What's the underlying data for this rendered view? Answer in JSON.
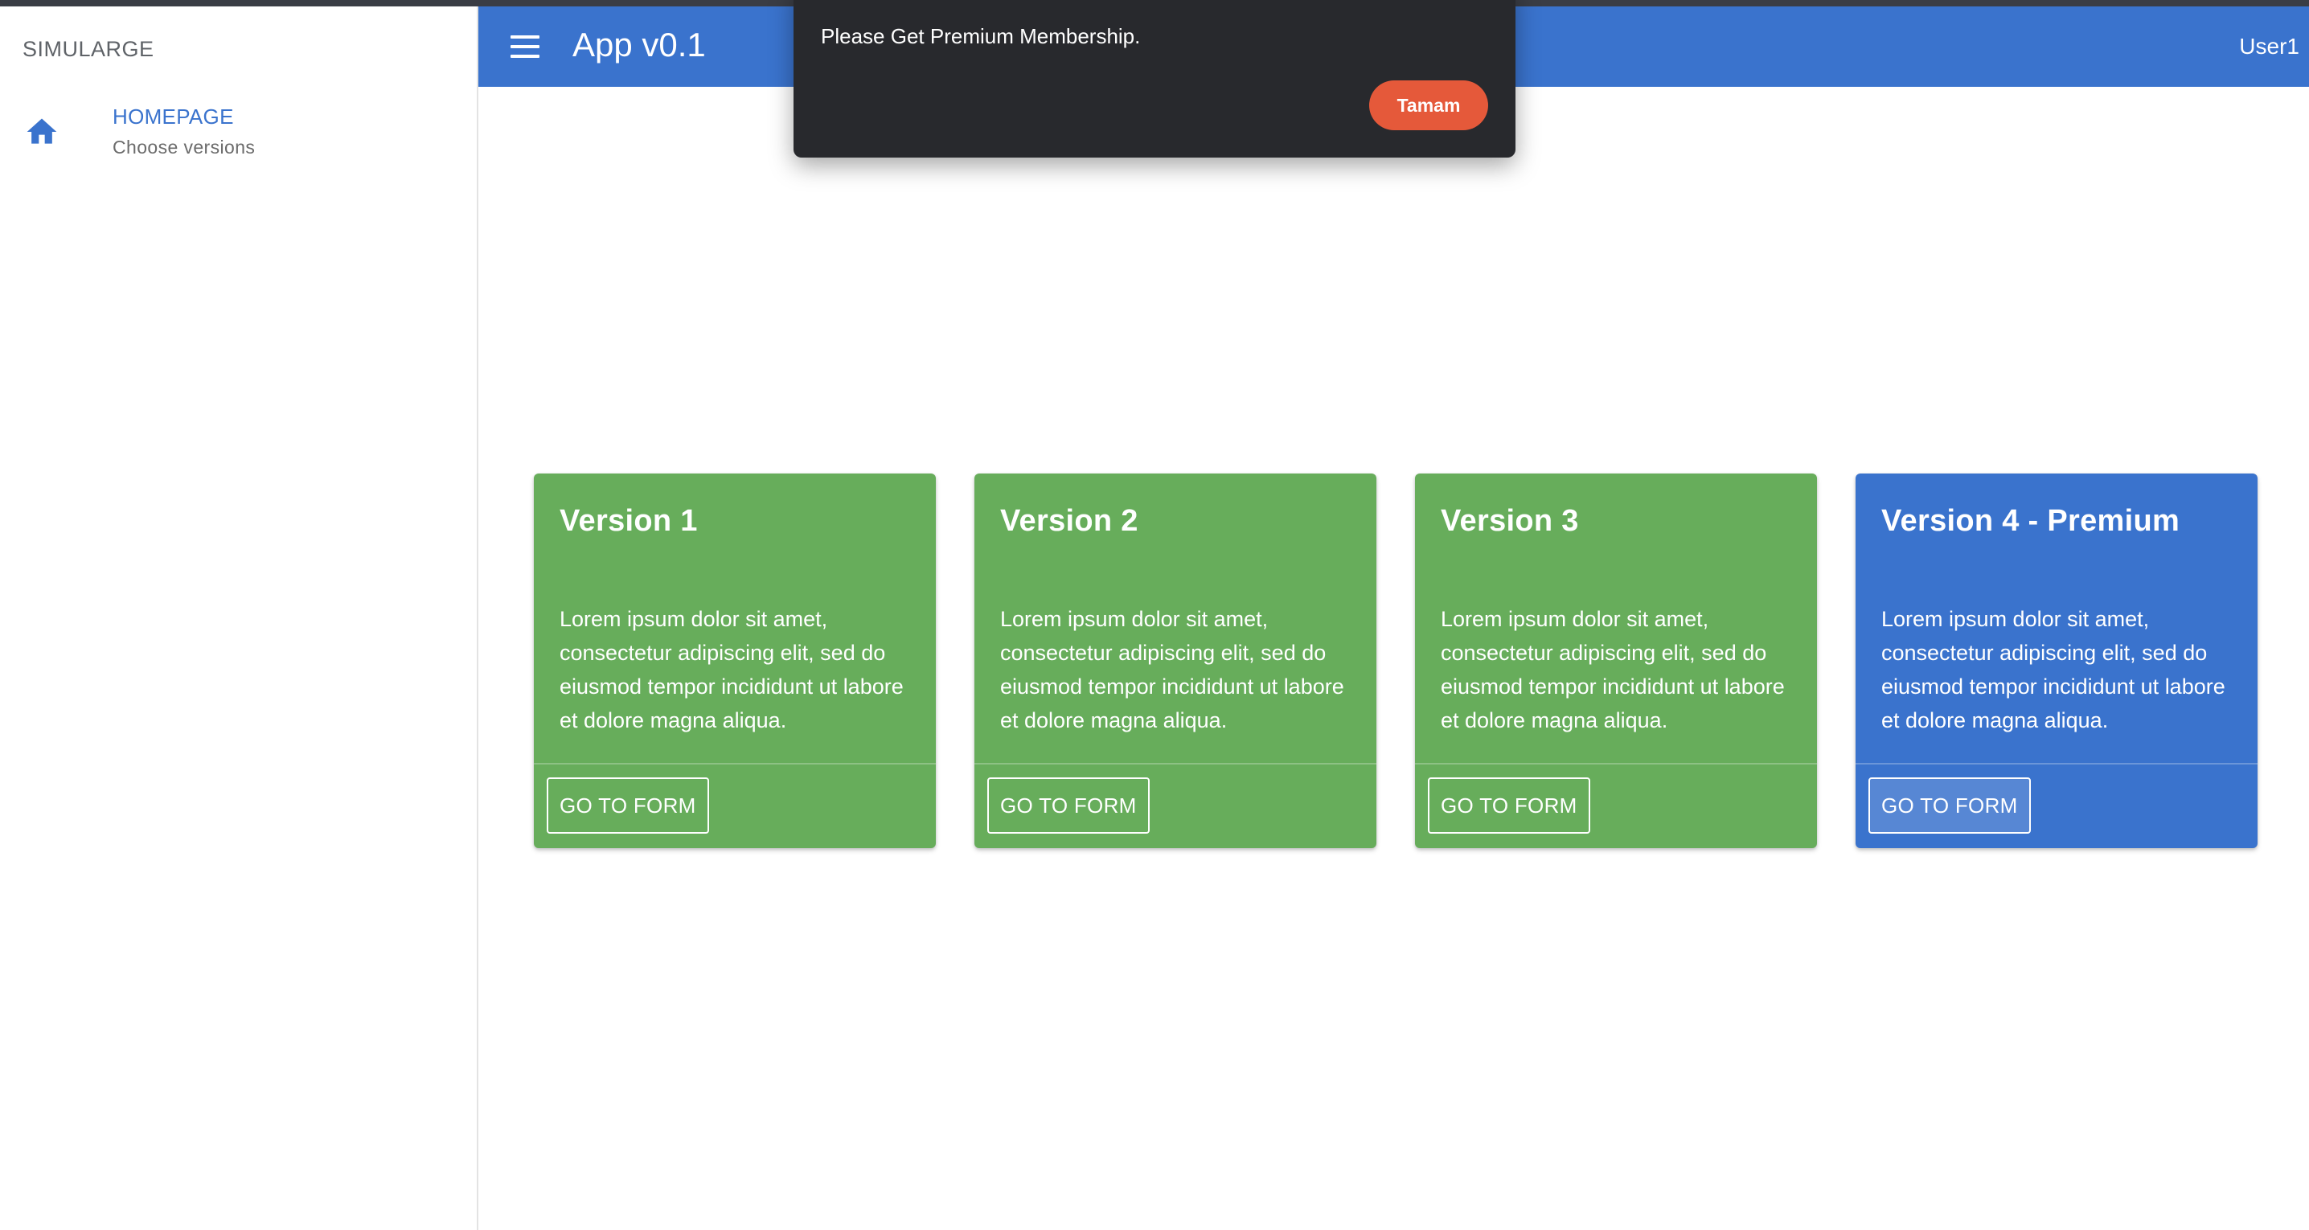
{
  "sidebar": {
    "brand": "SIMULARGE",
    "items": [
      {
        "label": "HOMEPAGE",
        "sublabel": "Choose versions",
        "icon": "home-icon"
      }
    ]
  },
  "appbar": {
    "title": "App v0.1",
    "user": "User1",
    "menu_icon": "hamburger-menu-icon"
  },
  "cards": [
    {
      "title": "Version 1",
      "text": "Lorem ipsum dolor sit amet, consectetur adipiscing elit, sed do eiusmod tempor incididunt ut labore et dolore magna aliqua.",
      "button": "GO TO FORM",
      "color": "#67ad5b"
    },
    {
      "title": "Version 2",
      "text": "Lorem ipsum dolor sit amet, consectetur adipiscing elit, sed do eiusmod tempor incididunt ut labore et dolore magna aliqua.",
      "button": "GO TO FORM",
      "color": "#67ad5b"
    },
    {
      "title": "Version 3",
      "text": "Lorem ipsum dolor sit amet, consectetur adipiscing elit, sed do eiusmod tempor incididunt ut labore et dolore magna aliqua.",
      "button": "GO TO FORM",
      "color": "#67ad5b"
    },
    {
      "title": "Version 4 - Premium",
      "text": "Lorem ipsum dolor sit amet, consectetur adipiscing elit, sed do eiusmod tempor incididunt ut labore et dolore magna aliqua.",
      "button": "GO TO FORM",
      "color": "#3a73cd"
    }
  ],
  "dialog": {
    "message": "Please Get Premium Membership.",
    "button": "Tamam",
    "button_color": "#e5593a"
  },
  "colors": {
    "primary": "#3a73cd",
    "green": "#67ad5b",
    "dialog_bg": "#28292d"
  }
}
